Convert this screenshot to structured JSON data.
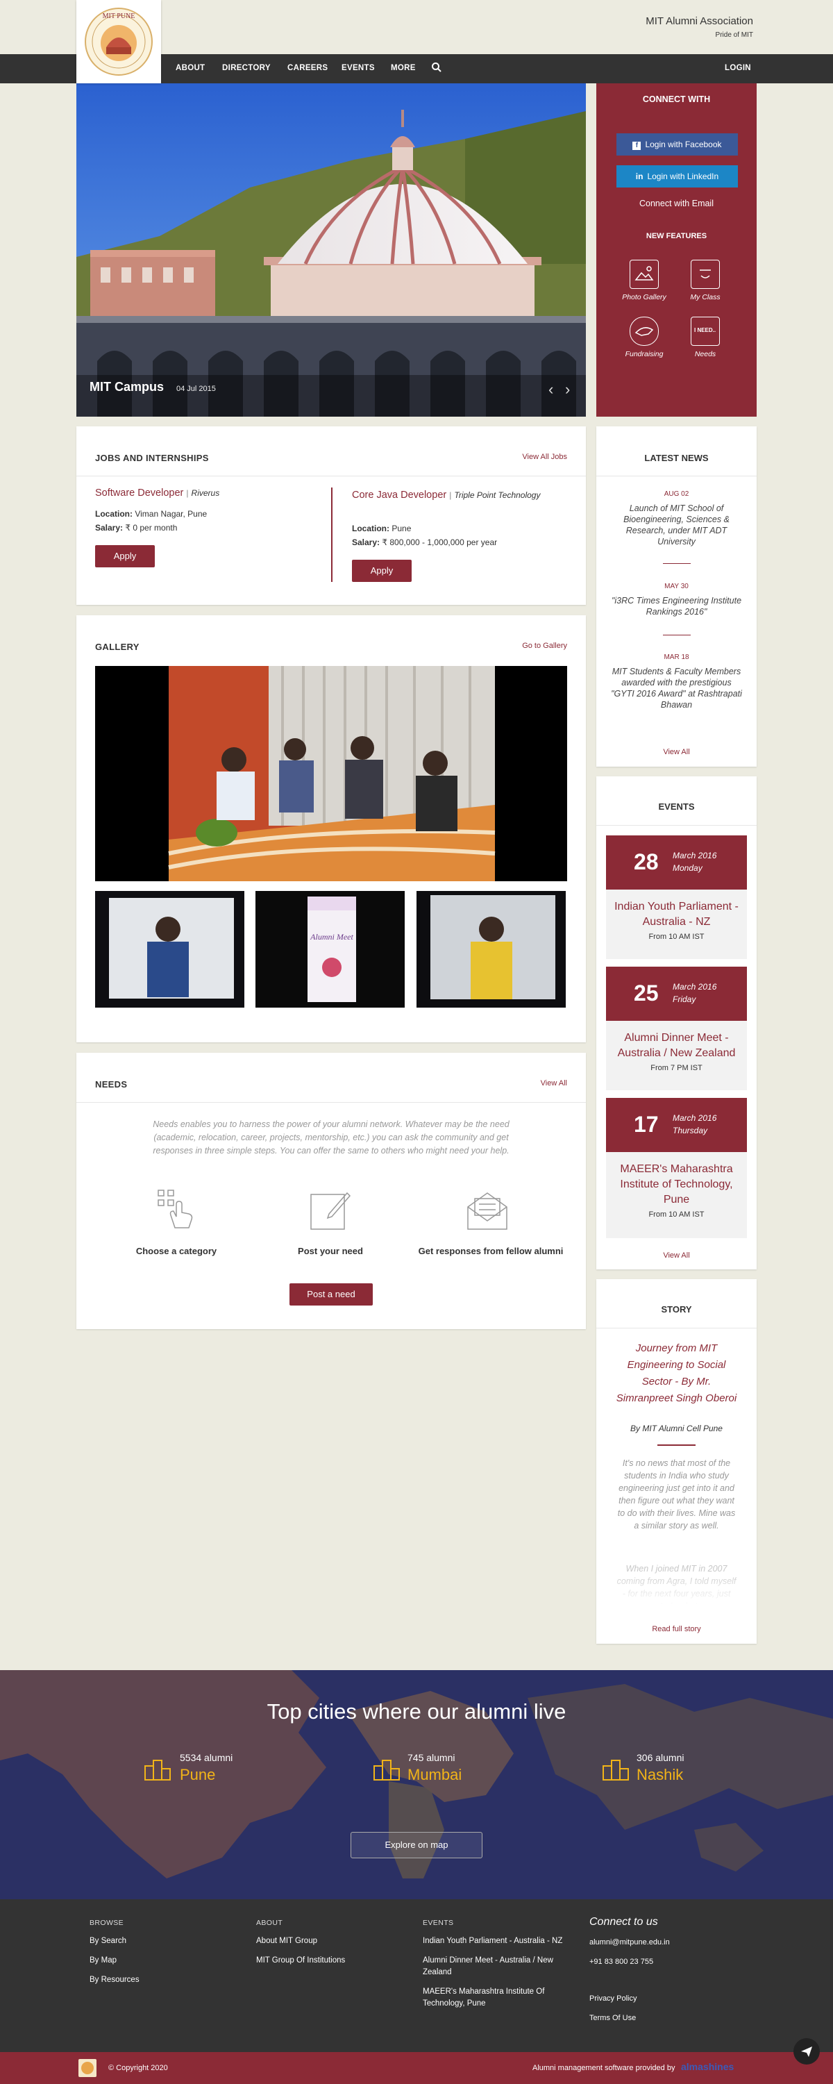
{
  "header": {
    "org_name": "MIT Alumni Association",
    "tagline": "Pride of MIT",
    "logo_text": "MIT PUNE",
    "nav": [
      "ABOUT",
      "DIRECTORY",
      "CAREERS",
      "EVENTS",
      "MORE"
    ],
    "login": "LOGIN"
  },
  "hero": {
    "caption": "MIT Campus",
    "date": "04 Jul 2015"
  },
  "connect": {
    "title": "CONNECT WITH",
    "facebook": "Login with Facebook",
    "linkedin": "Login with LinkedIn",
    "email": "Connect with Email",
    "features_title": "NEW FEATURES",
    "features": [
      "Photo Gallery",
      "My Class",
      "Fundraising",
      "Needs"
    ],
    "needs_icon_text": "I NEED..",
    "facebook_color": "#3b5998",
    "linkedin_color": "#1c86c6"
  },
  "jobs": {
    "title": "JOBS AND INTERNSHIPS",
    "view_all": "View All Jobs",
    "items": [
      {
        "role": "Software Developer",
        "sep": "|",
        "company": "Riverus",
        "location_label": "Location:",
        "location": "Viman Nagar, Pune",
        "salary_label": "Salary:",
        "salary": "₹ 0 per month",
        "apply": "Apply"
      },
      {
        "role": "Core Java Developer",
        "sep": "|",
        "company": "Triple Point Technology",
        "location_label": "Location:",
        "location": "Pune",
        "salary_label": "Salary:",
        "salary": "₹ 800,000 - 1,000,000 per year",
        "apply": "Apply"
      }
    ]
  },
  "gallery": {
    "title": "GALLERY",
    "link": "Go to Gallery",
    "poster_text": "Alumni Meet"
  },
  "needs": {
    "title": "NEEDS",
    "view_all": "View All",
    "description": "Needs enables you to harness the power of your alumni network. Whatever may be the need (academic, relocation, career, projects, mentorship, etc.) you can ask the community and get responses in three simple steps. You can offer the same to others who might need your help.",
    "steps": [
      "Choose a category",
      "Post your need",
      "Get responses from fellow alumni"
    ],
    "button": "Post a need"
  },
  "news": {
    "title": "LATEST NEWS",
    "items": [
      {
        "date": "AUG 02",
        "text": "Launch of MIT School of Bioengineering, Sciences & Research, under MIT ADT University"
      },
      {
        "date": "MAY 30",
        "text": "\"i3RC Times Engineering Institute Rankings 2016\""
      },
      {
        "date": "MAR 18",
        "text": "MIT Students & Faculty Members awarded with the prestigious \"GYTI 2016 Award\" at Rashtrapati Bhawan"
      }
    ],
    "view_all": "View All"
  },
  "events": {
    "title": "EVENTS",
    "items": [
      {
        "day": "28",
        "month": "March 2016",
        "weekday": "Monday",
        "title": "Indian Youth Parliament - Australia - NZ",
        "time": "From 10 AM IST"
      },
      {
        "day": "25",
        "month": "March 2016",
        "weekday": "Friday",
        "title": "Alumni Dinner Meet - Australia / New Zealand",
        "time": "From 7 PM IST"
      },
      {
        "day": "17",
        "month": "March 2016",
        "weekday": "Thursday",
        "title": "MAEER's Maharashtra Institute of Technology, Pune",
        "time": "From 10 AM IST"
      }
    ],
    "view_all": "View All"
  },
  "story": {
    "title": "STORY",
    "headline": "Journey from MIT Engineering to Social Sector - By Mr. Simranpreet Singh Oberoi",
    "byline": "By MIT Alumni Cell Pune",
    "p1": "It's no news that most of the students in India who study engineering just get into it and then figure out what they want to do with their lives.  Mine was a similar story as well.",
    "p2": "When I joined MIT in 2007 coming from Agra, I told myself - for the next four years, just study what",
    "link": "Read full story"
  },
  "cities": {
    "title": "Top cities where our alumni live",
    "items": [
      {
        "count": "5534 alumni",
        "name": "Pune"
      },
      {
        "count": "745 alumni",
        "name": "Mumbai"
      },
      {
        "count": "306 alumni",
        "name": "Nashik"
      }
    ],
    "button": "Explore on map"
  },
  "footer": {
    "browse_title": "BROWSE",
    "browse": [
      "By Search",
      "By Map",
      "By Resources"
    ],
    "about_title": "ABOUT",
    "about": [
      "About MIT Group",
      "MIT Group Of Institutions"
    ],
    "events_title": "EVENTS",
    "events": [
      "Indian Youth Parliament - Australia - NZ",
      "Alumni Dinner Meet - Australia / New Zealand",
      "MAEER's Maharashtra Institute Of Technology, Pune"
    ],
    "connect_title": "Connect to us",
    "email": "alumni@mitpune.edu.in",
    "phone": "+91 83 800 23 755",
    "privacy": "Privacy Policy",
    "terms": "Terms Of Use",
    "copyright": "© Copyright 2020",
    "provided_by": "Alumni management software provided by",
    "provider": "almashines"
  }
}
